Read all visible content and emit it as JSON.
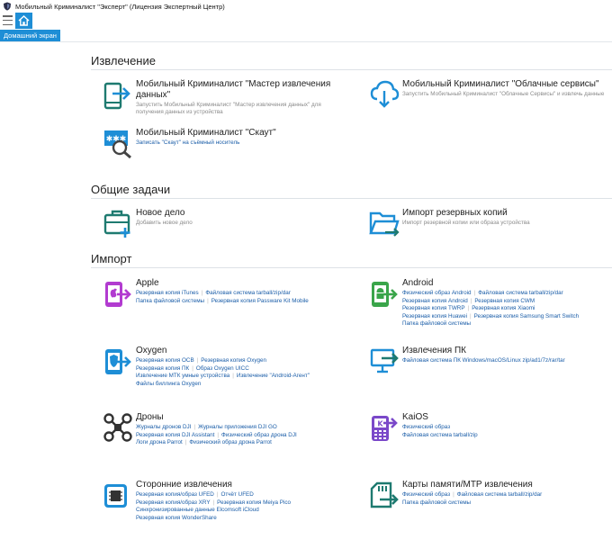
{
  "window": {
    "title": "Мобильный Криминалист \"Эксперт\" (Лицензия Экспертный Центр)"
  },
  "toolbar": {
    "menu_icon": "hamburger-icon",
    "home_icon": "home-icon",
    "home_tab": "Домашний экран"
  },
  "colors": {
    "accent": "#1e8ed6",
    "link": "#1a5da8",
    "apple": "#b23bd0",
    "android": "#3aa54a",
    "kaios": "#7a48c9",
    "cards": "#1e7a70",
    "dark": "#333333"
  },
  "sections": {
    "extraction": {
      "title": "Извлечение",
      "items": [
        {
          "title": "Мобильный Криминалист \"Мастер извлечения данных\"",
          "desc": "Запустить Мобильный Криминалист \"Мастер извлечения данных\" для получения данных из устройства",
          "icon": "phone-extract-icon"
        },
        {
          "title": "Мобильный Криминалист \"Облачные сервисы\"",
          "desc": "Запустить Мобильный Криминалист \"Облачные Сервисы\" и извлечь данные",
          "icon": "cloud-download-icon"
        },
        {
          "title": "Мобильный Криминалист \"Скаут\"",
          "desc": "Записать \"Скаут\" на съёмный носитель",
          "icon": "scout-search-icon"
        }
      ]
    },
    "tasks": {
      "title": "Общие задачи",
      "items": [
        {
          "title": "Новое дело",
          "desc": "Добавить новое дело",
          "icon": "new-case-icon"
        },
        {
          "title": "Импорт резервных копий",
          "desc": "Импорт резервной копии или образа устройства",
          "icon": "import-folder-icon"
        }
      ]
    },
    "import": {
      "title": "Импорт",
      "items": [
        {
          "title": "Apple",
          "icon": "apple-icon",
          "lines": [
            [
              "Резервная копия iTunes",
              "Файловая система tarball/zip/dar"
            ],
            [
              "Папка файловой системы",
              "Резервная копия Passware Kit Mobile"
            ]
          ]
        },
        {
          "title": "Android",
          "icon": "android-icon",
          "lines": [
            [
              "Физический образ Android",
              "Файловая система tarball/zip/dar"
            ],
            [
              "Резервная копия Android",
              "Резервная копия CWM"
            ],
            [
              "Резервная копия TWRP",
              "Резервная копия Xiaomi"
            ],
            [
              "Резервная копия Huawei",
              "Резервная копия Samsung Smart Switch"
            ],
            [
              "Папка файловой системы"
            ]
          ]
        },
        {
          "title": "Oxygen",
          "icon": "oxygen-shield-icon",
          "lines": [
            [
              "Резервная копия OCB",
              "Резервная копия Oxygen"
            ],
            [
              "Резервная копия ПК",
              "Образ Oxygen UICC"
            ],
            [
              "Извлечение МТК умные устройства",
              "Извлечение \"Android-Агент\""
            ],
            [
              "Файлы биллинга Oxygen"
            ]
          ]
        },
        {
          "title": "Извлечения ПК",
          "icon": "pc-extraction-icon",
          "lines": [
            [
              "Файловая система ПК Windows/macOS/Linux zip/ad1/7z/rar/tar"
            ]
          ]
        },
        {
          "title": "Дроны",
          "icon": "drone-icon",
          "lines": [
            [
              "Журналы дронов DJI",
              "Журналы приложения DJI GO"
            ],
            [
              "Резервная копия DJI Assistant",
              "Физический образ дрона DJI"
            ],
            [
              "Логи дрона Parrot",
              "Физический образ дрона Parrot"
            ]
          ]
        },
        {
          "title": "KaiOS",
          "icon": "kaios-icon",
          "lines": [
            [
              "Физический образ"
            ],
            [
              "Файловая система tarball/zip"
            ]
          ]
        },
        {
          "title": "Сторонние извлечения",
          "icon": "third-party-chip-icon",
          "lines": [
            [
              "Резервная копия/образ UFED",
              "Отчёт UFED"
            ],
            [
              "Резервная копия/образ XRY",
              "Резервная копия Meiya Pico"
            ],
            [
              "Синхронизированные данные Elcomsoft iCloud"
            ],
            [
              "Резервная копия WonderShare"
            ]
          ]
        },
        {
          "title": "Карты памяти/MTP извлечения",
          "icon": "memory-card-icon",
          "lines": [
            [
              "Физический образ",
              "Файловая система tarball/zip/dar"
            ],
            [
              "Папка файловой системы"
            ]
          ]
        }
      ]
    }
  }
}
